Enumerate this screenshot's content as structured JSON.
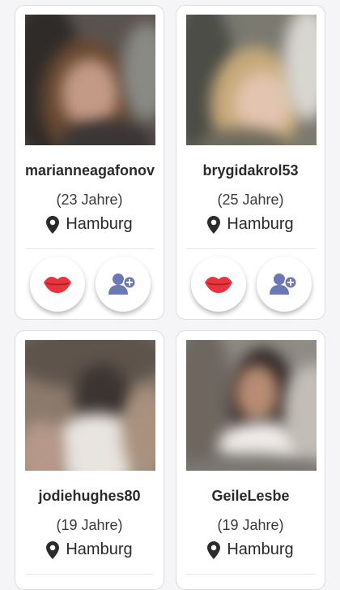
{
  "profiles": [
    {
      "username": "marianneagafonov",
      "age": "(23 Jahre)",
      "city": "Hamburg"
    },
    {
      "username": "brygidakrol53",
      "age": "(25 Jahre)",
      "city": "Hamburg"
    },
    {
      "username": "jodiehughes80",
      "age": "(19 Jahre)",
      "city": "Hamburg"
    },
    {
      "username": "GeileLesbe",
      "age": "(19 Jahre)",
      "city": "Hamburg"
    }
  ],
  "icons": {
    "location": "map-pin-icon",
    "kiss": "lips-icon",
    "add_friend": "add-user-icon"
  },
  "colors": {
    "lips": "#e8343f",
    "add_user": "#6b78b5",
    "pin": "#2b2b2b"
  }
}
